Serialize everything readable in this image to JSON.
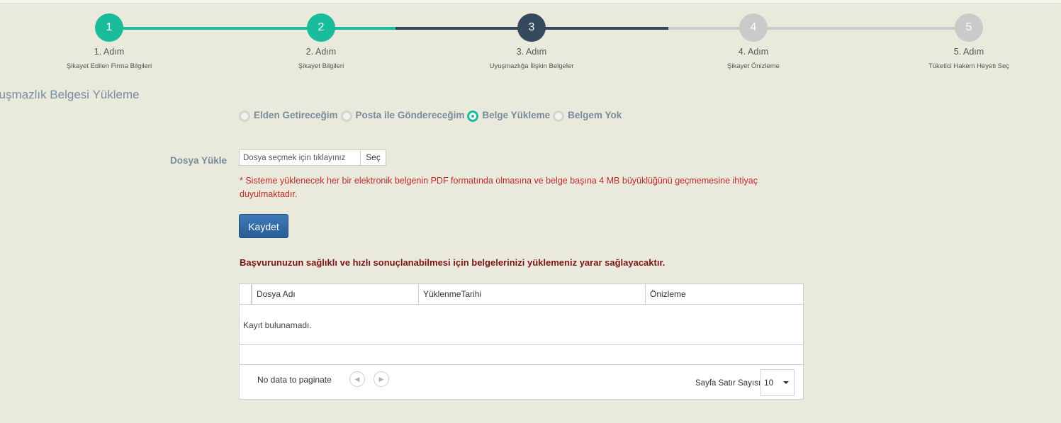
{
  "colors": {
    "completed": "#1abc9c",
    "active": "#34495e",
    "pending": "#cacaca",
    "warning": "#c0282c",
    "info": "#7d1418",
    "button": "#2f6aa5"
  },
  "steps": [
    {
      "number": "1",
      "label": "1. Adım",
      "sub": "Şikayet Edilen Firma Bilgileri",
      "state": "completed"
    },
    {
      "number": "2",
      "label": "2. Adım",
      "sub": "Şikayet Bilgileri",
      "state": "completed"
    },
    {
      "number": "3",
      "label": "3. Adım",
      "sub": "Uyuşmazlığa İlişkin Belgeler",
      "state": "active"
    },
    {
      "number": "4",
      "label": "4. Adım",
      "sub": "Şikayet Önizleme",
      "state": "pending"
    },
    {
      "number": "5",
      "label": "5. Adım",
      "sub": "Tüketici Hakem Heyeti Seç",
      "state": "pending"
    }
  ],
  "section_title": "yuşmazlık Belgesi Yükleme",
  "radios": [
    {
      "label": "Elden Getireceğim",
      "checked": false
    },
    {
      "label": "Posta ile Göndereceğim",
      "checked": false
    },
    {
      "label": "Belge Yükleme",
      "checked": true
    },
    {
      "label": "Belgem Yok",
      "checked": false
    }
  ],
  "upload": {
    "label": "Dosya Yükle",
    "placeholder": "Dosya seçmek için tıklayınız",
    "button": "Seç"
  },
  "warning": "* Sisteme yüklenecek her bir elektronik belgenin PDF formatında olmasına ve belge başına 4 MB büyüklüğünü geçmemesine ihtiyaç duyulmaktadır.",
  "save_label": "Kaydet",
  "info_text": "Başvurunuzun sağlıklı ve hızlı sonuçlanabilmesi için belgelerinizi yüklemeniz yarar sağlayacaktır.",
  "grid": {
    "columns": [
      "Dosya Adı",
      "YüklenmeTarihi",
      "Önizleme"
    ],
    "empty_text": "Kayıt bulunamadı.",
    "pager_text": "No data to paginate",
    "rows_label": "Sayfa Satır Sayısı",
    "rows_value": "10"
  }
}
